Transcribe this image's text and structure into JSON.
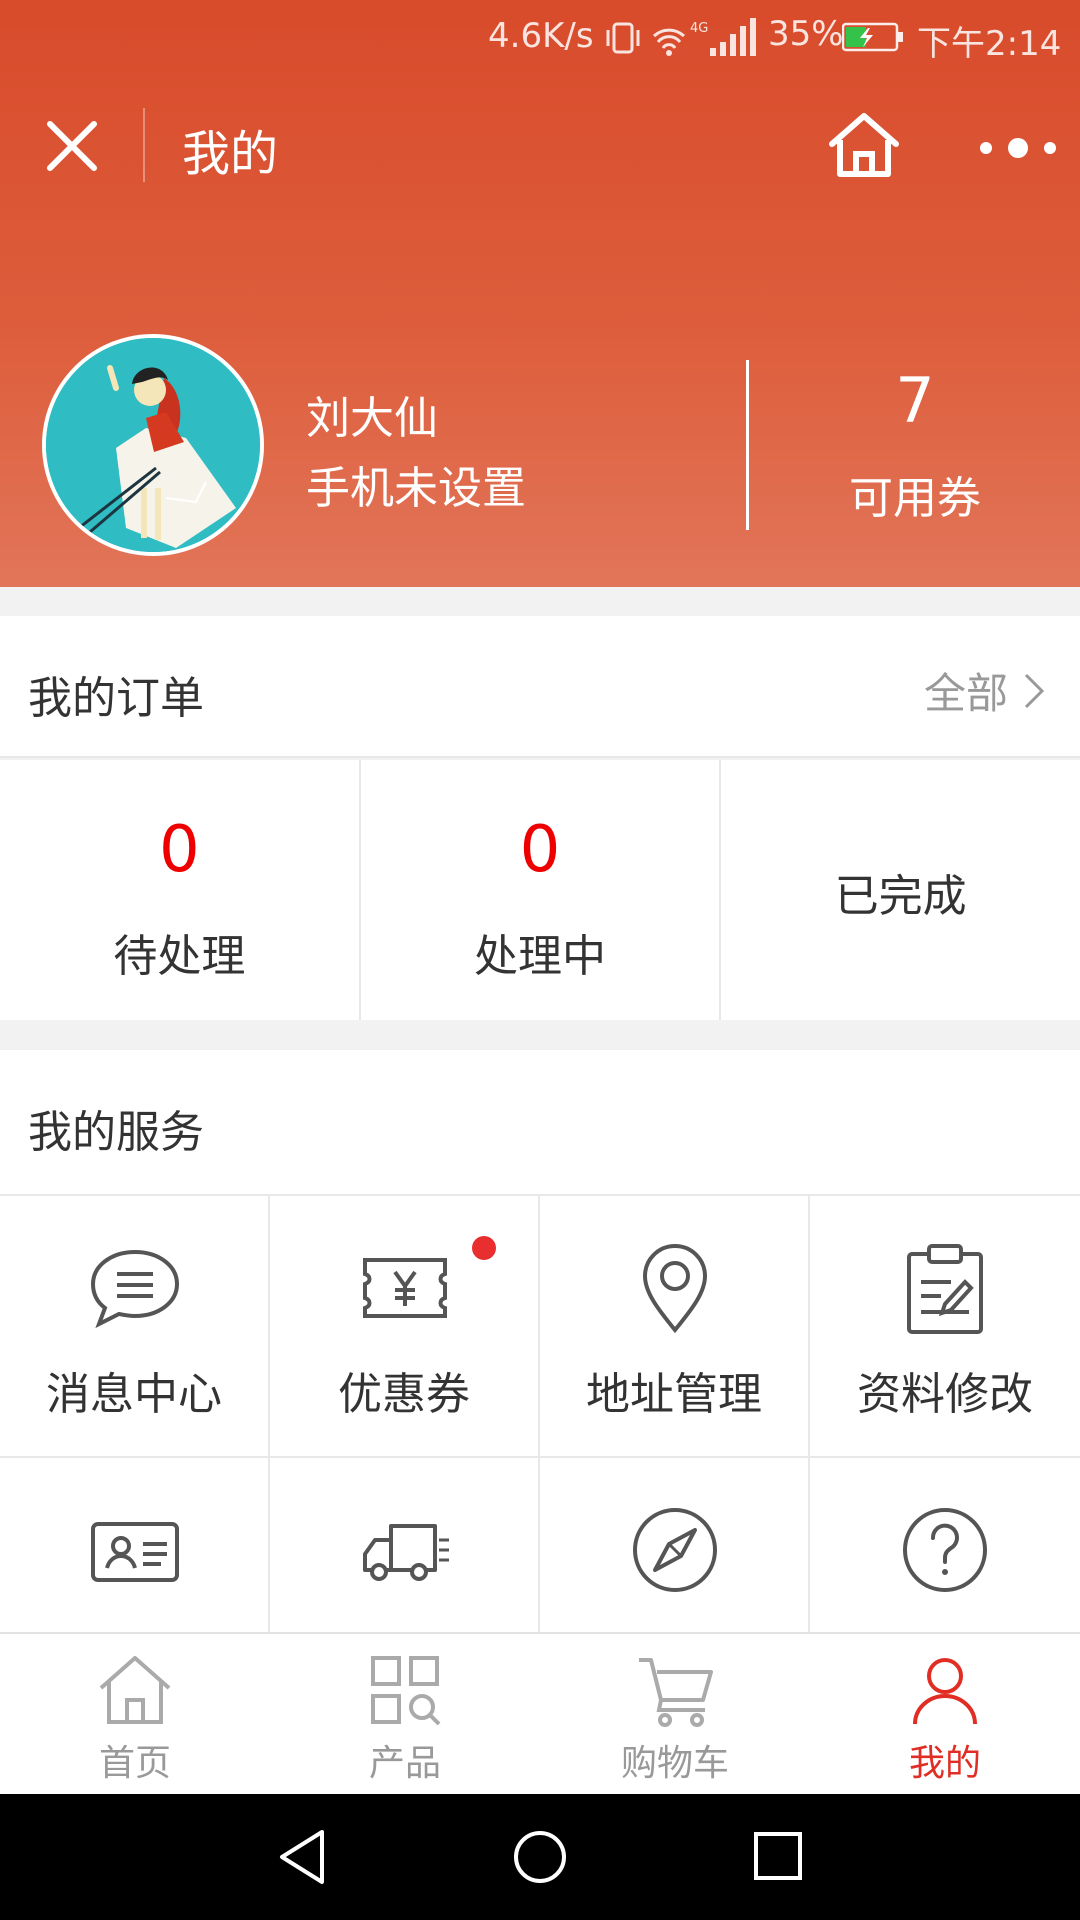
{
  "status_bar": {
    "net_speed": "4.6K/s",
    "battery_percent": "35%",
    "time": "下午2:14"
  },
  "nav": {
    "title": "我的"
  },
  "profile": {
    "name": "刘大仙",
    "phone": "手机未设置",
    "coupon_count": "7",
    "coupon_label": "可用券"
  },
  "orders": {
    "title": "我的订单",
    "all_label": "全部",
    "items": [
      {
        "count": "0",
        "label": "待处理"
      },
      {
        "count": "0",
        "label": "处理中"
      },
      {
        "label": "已完成"
      }
    ]
  },
  "services": {
    "title": "我的服务",
    "items": [
      {
        "label": "消息中心",
        "icon": "message-icon"
      },
      {
        "label": "优惠券",
        "icon": "coupon-icon",
        "badge": true
      },
      {
        "label": "地址管理",
        "icon": "location-icon"
      },
      {
        "label": "资料修改",
        "icon": "clipboard-edit-icon"
      },
      {
        "icon": "id-card-icon"
      },
      {
        "icon": "delivery-truck-icon"
      },
      {
        "icon": "compass-icon"
      },
      {
        "icon": "help-icon"
      }
    ]
  },
  "tabbar": {
    "items": [
      {
        "label": "首页",
        "icon": "home-icon"
      },
      {
        "label": "产品",
        "icon": "product-grid-icon"
      },
      {
        "label": "购物车",
        "icon": "cart-icon"
      },
      {
        "label": "我的",
        "icon": "user-icon",
        "active": true
      }
    ]
  },
  "colors": {
    "header_top": "#d84b2b",
    "header_bottom": "#e27559",
    "accent_red": "#e00000",
    "tab_active": "#e02e24",
    "badge": "#e82e2e"
  }
}
